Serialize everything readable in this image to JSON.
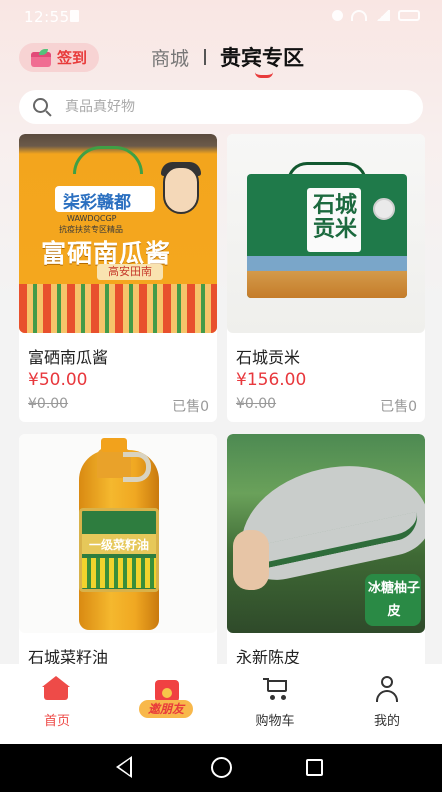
{
  "status_bar": {
    "time": "12:55"
  },
  "header": {
    "sign_label": "签到",
    "tabs": [
      {
        "label": "商城",
        "active": false
      },
      {
        "label": "贵宾专区",
        "active": true
      }
    ]
  },
  "search": {
    "placeholder": "真品真好物",
    "value": ""
  },
  "products": [
    {
      "name": "富硒南瓜酱",
      "price": "¥50.00",
      "original_price": "¥0.00",
      "sold": "已售0",
      "image": {
        "brand": "柒彩赣都",
        "latin": "WAWDQCGP",
        "slogan": "抗疫扶贫专区精品",
        "title": "富硒南瓜酱",
        "origin": "高安田南"
      }
    },
    {
      "name": "石城贡米",
      "price": "¥156.00",
      "original_price": "¥0.00",
      "sold": "已售0",
      "image": {
        "label": "石城贡米"
      }
    },
    {
      "name": "石城菜籽油",
      "price": "",
      "original_price": "",
      "sold": "",
      "image": {
        "label": "一级菜籽油"
      }
    },
    {
      "name": "永新陈皮",
      "price": "",
      "original_price": "",
      "sold": "",
      "image": {
        "badge": "冰糖柚子皮"
      }
    }
  ],
  "tabbar": {
    "items": [
      {
        "label": "首页",
        "icon": "home-icon",
        "active": true
      },
      {
        "label": "邀朋友",
        "icon": "red-envelope-icon",
        "active": false
      },
      {
        "label": "购物车",
        "icon": "cart-icon",
        "active": false
      },
      {
        "label": "我的",
        "icon": "user-icon",
        "active": false
      }
    ]
  },
  "colors": {
    "accent": "#e8383d",
    "price": "#e8383d",
    "tab_active": "#ee4b48"
  }
}
